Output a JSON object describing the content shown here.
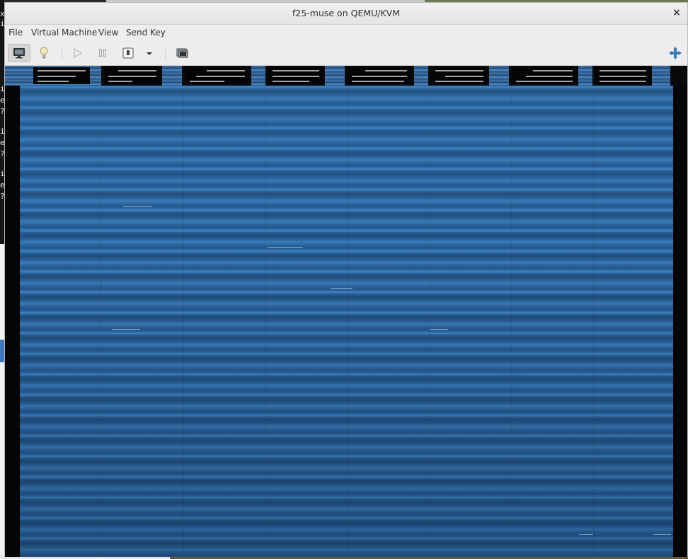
{
  "window": {
    "title": "f25-muse on QEMU/KVM",
    "close_glyph": "×"
  },
  "menubar": {
    "items": [
      {
        "label": "File"
      },
      {
        "label": "Virtual Machine"
      },
      {
        "label": "View"
      },
      {
        "label": "Send Key"
      }
    ]
  },
  "toolbar": {
    "buttons": [
      {
        "icon": "monitor-icon",
        "name": "show-console-button",
        "active": true
      },
      {
        "icon": "lightbulb-icon",
        "name": "show-details-button",
        "active": false
      },
      {
        "icon": "play-icon",
        "name": "run-button",
        "active": false
      },
      {
        "icon": "pause-icon",
        "name": "pause-button",
        "active": false
      },
      {
        "icon": "power-icon",
        "name": "shutdown-button",
        "active": false
      },
      {
        "icon": "chevron-down-icon",
        "name": "shutdown-menu-button",
        "active": false
      },
      {
        "icon": "snapshot-icon",
        "name": "snapshots-button",
        "active": false
      },
      {
        "icon": "fullscreen-icon",
        "name": "fullscreen-button",
        "active": false
      }
    ]
  },
  "desktop": {
    "left_edge_glyphs": [
      "x",
      "i",
      "i",
      "e",
      "?",
      "i",
      "e",
      "?",
      "i",
      "e",
      "?"
    ]
  },
  "colors": {
    "guest_blue": "#2f6aa4",
    "guest_dark": "#050505",
    "titlebar": "#ebebeb"
  }
}
